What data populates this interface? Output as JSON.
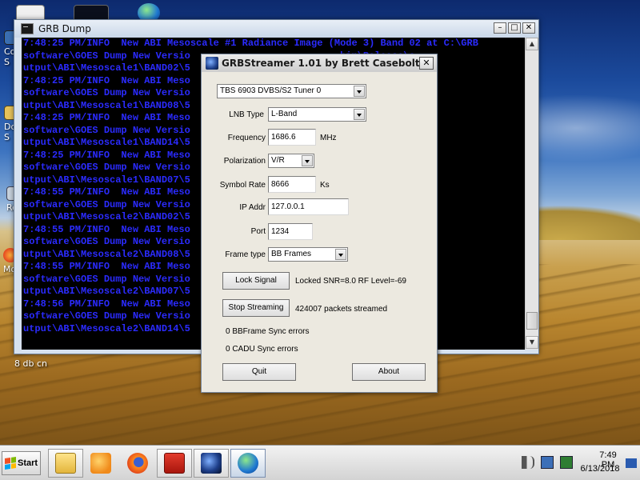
{
  "desktop": {
    "icons": [
      {
        "label": "Co\nS"
      },
      {
        "label": "Do\nS"
      },
      {
        "label": "Re"
      },
      {
        "label": "Moz"
      },
      {
        "label": "8 db cn"
      }
    ]
  },
  "console": {
    "title": "GRB Dump",
    "lines": [
      "7:48:25 PM/INFO  New ABI Mesoscale #1 Radiance Image (Mode 3) Band 02 at C:\\GRB",
      "software\\GOES Dump New Versio                          bin\\Release\\o",
      "utput\\ABI\\Mesoscale1\\BAND02\\5",
      "7:48:25 PM/INFO  New ABI Meso                          08 at C:\\GRB",
      "software\\GOES Dump New Versio                          bin\\Release\\o",
      "utput\\ABI\\Mesoscale1\\BAND08\\5",
      "7:48:25 PM/INFO  New ABI Meso                          14 at C:\\GRB",
      "software\\GOES Dump New Versio                          bin\\Release\\o",
      "utput\\ABI\\Mesoscale1\\BAND14\\5",
      "7:48:25 PM/INFO  New ABI Meso                          07 at C:\\GRB",
      "software\\GOES Dump New Versio                          bin\\Release\\o",
      "utput\\ABI\\Mesoscale1\\BAND07\\5",
      "7:48:55 PM/INFO  New ABI Meso                          02 at C:\\GRB",
      "software\\GOES Dump New Versio                          bin\\Release\\o",
      "utput\\ABI\\Mesoscale2\\BAND02\\5",
      "7:48:55 PM/INFO  New ABI Meso                          08 at C:\\GRB",
      "software\\GOES Dump New Versio                          bin\\Release\\o",
      "utput\\ABI\\Mesoscale2\\BAND08\\5",
      "7:48:55 PM/INFO  New ABI Meso                          07 at C:\\GRB",
      "software\\GOES Dump New Versio                          bin\\Release\\o",
      "utput\\ABI\\Mesoscale2\\BAND07\\5",
      "7:48:56 PM/INFO  New ABI Meso                          14 at C:\\GRB",
      "software\\GOES Dump New Versio                          bin\\Release\\o",
      "utput\\ABI\\Mesoscale2\\BAND14\\5"
    ]
  },
  "dialog": {
    "title": "GRBStreamer 1.01 by Brett Casebolt",
    "tuner": "TBS 6903 DVBS/S2 Tuner 0",
    "lnb_type": {
      "label": "LNB Type",
      "value": "L-Band"
    },
    "frequency": {
      "label": "Frequency",
      "value": "1686.6",
      "unit": "MHz"
    },
    "polarization": {
      "label": "Polarization",
      "value": "V/R"
    },
    "symbol_rate": {
      "label": "Symbol Rate",
      "value": "8666",
      "unit": "Ks"
    },
    "ip_addr": {
      "label": "IP Addr",
      "value": "127.0.0.1"
    },
    "port": {
      "label": "Port",
      "value": "1234"
    },
    "frame_type": {
      "label": "Frame type",
      "value": "BB Frames"
    },
    "lock_button": "Lock Signal",
    "lock_status": "Locked  SNR=8.0 RF Level=-69",
    "stream_button": "Stop Streaming",
    "stream_status": "424007 packets streamed",
    "bbframe_errors": "0 BBFrame Sync errors",
    "cadu_errors": "0 CADU Sync errors",
    "quit_button": "Quit",
    "about_button": "About"
  },
  "taskbar": {
    "start_label": "Start",
    "items": [
      {
        "icon": "file-explorer-icon"
      },
      {
        "icon": "media-player-icon"
      },
      {
        "icon": "firefox-icon"
      },
      {
        "icon": "acrobat-icon"
      },
      {
        "icon": "grbstreamer-icon"
      },
      {
        "icon": "globe-app-icon"
      }
    ],
    "tray": {
      "icons": [
        "speaker-icon",
        "network-icon",
        "power-icon",
        "action-center-icon"
      ]
    },
    "clock": {
      "time": "7:49 PM",
      "date": "6/13/2018"
    }
  },
  "colors": {
    "console_text": "#2b2bff",
    "console_bg": "#000000",
    "dialog_bg": "#ece9e0"
  }
}
